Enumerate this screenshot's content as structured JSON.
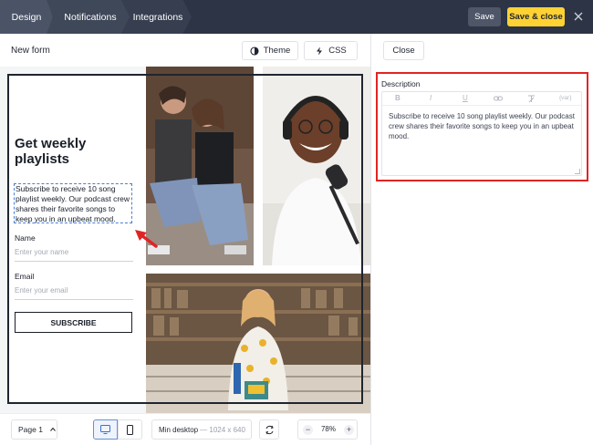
{
  "topbar": {
    "tabs": [
      {
        "label": "Design"
      },
      {
        "label": "Notifications"
      },
      {
        "label": "Integrations"
      }
    ],
    "save_label": "Save",
    "save_close_label": "Save & close",
    "accent_color": "#ffd233"
  },
  "toolbar": {
    "form_name": "New form",
    "theme_label": "Theme",
    "css_label": "CSS"
  },
  "form": {
    "title": "Get weekly playlists",
    "description": "Subscribe to receive 10 song playlist weekly. Our podcast crew shares their favorite songs to keep you in an upbeat mood.",
    "name_label": "Name",
    "name_placeholder": "Enter your name",
    "email_label": "Email",
    "email_placeholder": "Enter your email",
    "button_label": "SUBSCRIBE"
  },
  "panel": {
    "close_label": "Close",
    "field_label": "Description",
    "editor_tools": [
      "B",
      "I",
      "U",
      "link-icon",
      "clear-format-icon",
      "{var}"
    ],
    "editor_var_label": "{var}",
    "editor_value": "Subscribe to receive 10 song playlist weekly. Our podcast crew shares their favorite songs to keep you in an upbeat mood.",
    "highlight_color": "#e02424"
  },
  "bottombar": {
    "page_label": "Page 1",
    "size_label": "Min desktop",
    "size_dims": "— 1024 x 640",
    "zoom": "78%"
  }
}
